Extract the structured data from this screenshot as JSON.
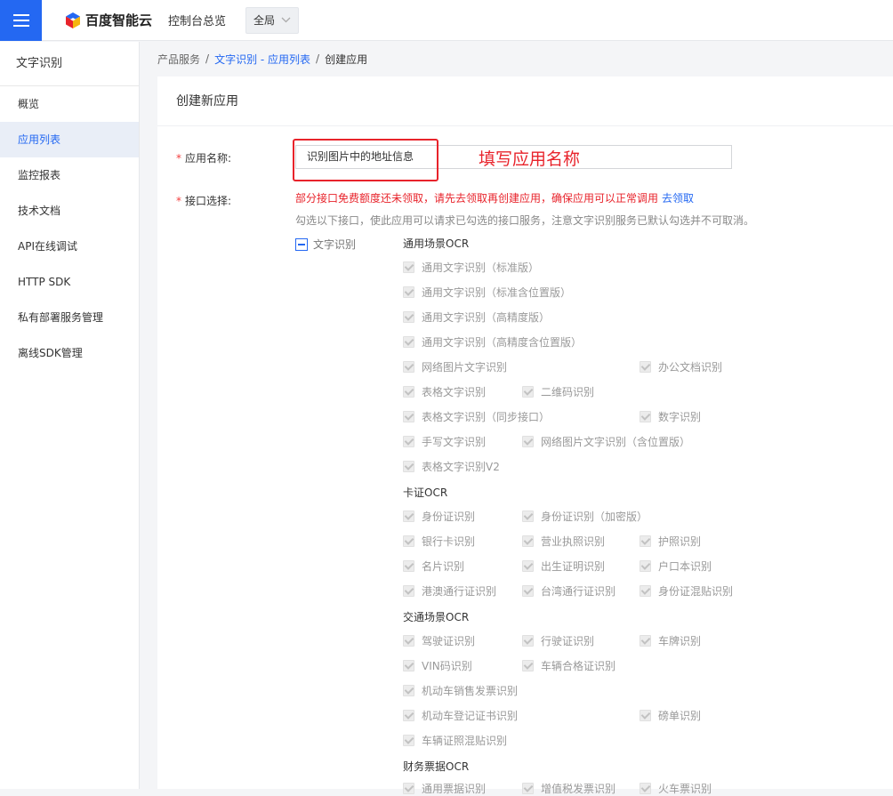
{
  "topbar": {
    "logo_text": "百度智能云",
    "console_link": "控制台总览",
    "region": "全局"
  },
  "sidebar": {
    "title": "文字识别",
    "items": [
      {
        "label": "概览",
        "active": false
      },
      {
        "label": "应用列表",
        "active": true
      },
      {
        "label": "监控报表",
        "active": false
      },
      {
        "label": "技术文档",
        "active": false
      },
      {
        "label": "API在线调试",
        "active": false
      },
      {
        "label": "HTTP SDK",
        "active": false
      },
      {
        "label": "私有部署服务管理",
        "active": false
      },
      {
        "label": "离线SDK管理",
        "active": false
      }
    ]
  },
  "breadcrumb": {
    "root": "产品服务",
    "sep": "/",
    "link": "文字识别 - 应用列表",
    "current": "创建应用"
  },
  "card": {
    "title": "创建新应用"
  },
  "form": {
    "app_name_label": "应用名称:",
    "app_name_value": "识别图片中的地址信息",
    "annotation": "填写应用名称",
    "api_label": "接口选择:",
    "warning": "部分接口免费额度还未领取，请先去领取再创建应用，确保应用可以正常调用",
    "warning_link": "去领取",
    "hint": "勾选以下接口，使此应用可以请求已勾选的接口服务，注意文字识别服务已默认勾选并不可取消。",
    "category": "文字识别"
  },
  "groups": {
    "general": "通用场景OCR",
    "card": "卡证OCR",
    "traffic": "交通场景OCR",
    "finance": "财务票据OCR"
  },
  "items": {
    "g1": "通用文字识别（标准版）",
    "g2": "通用文字识别（标准含位置版）",
    "g3": "通用文字识别（高精度版）",
    "g4": "通用文字识别（高精度含位置版）",
    "g5": "网络图片文字识别",
    "g6": "办公文档识别",
    "g7": "表格文字识别",
    "g8": "二维码识别",
    "g9": "表格文字识别（同步接口）",
    "g10": "数字识别",
    "g11": "手写文字识别",
    "g12": "网络图片文字识别（含位置版）",
    "g13": "表格文字识别V2",
    "c1": "身份证识别",
    "c2": "身份证识别（加密版）",
    "c3": "银行卡识别",
    "c4": "营业执照识别",
    "c5": "护照识别",
    "c6": "名片识别",
    "c7": "出生证明识别",
    "c8": "户口本识别",
    "c9": "港澳通行证识别",
    "c10": "台湾通行证识别",
    "c11": "身份证混贴识别",
    "t1": "驾驶证识别",
    "t2": "行驶证识别",
    "t3": "车牌识别",
    "t4": "VIN码识别",
    "t5": "车辆合格证识别",
    "t6": "机动车销售发票识别",
    "t7": "机动车登记证书识别",
    "t8": "磅单识别",
    "t9": "车辆证照混贴识别",
    "f1": "通用票据识别",
    "f2": "增值税发票识别",
    "f3": "火车票识别"
  }
}
